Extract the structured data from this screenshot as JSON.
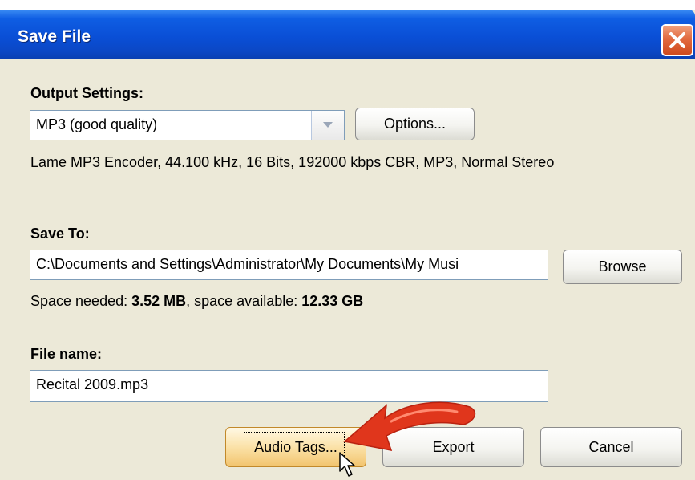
{
  "window": {
    "title": "Save File"
  },
  "output_settings": {
    "label": "Output Settings:",
    "selected_format": "MP3 (good quality)",
    "options_button": "Options...",
    "encoder_info": "Lame MP3 Encoder, 44.100 kHz, 16 Bits, 192000 kbps CBR, MP3, Normal Stereo"
  },
  "save_to": {
    "label": "Save To:",
    "path": "C:\\Documents and Settings\\Administrator\\My Documents\\My Musi",
    "browse_button": "Browse",
    "space_needed_label": "Space needed: ",
    "space_needed_value": "3.52 MB",
    "space_available_label": ", space available: ",
    "space_available_value": "12.33 GB"
  },
  "file_name": {
    "label": "File name:",
    "value": "Recital 2009.mp3"
  },
  "buttons": {
    "audio_tags": "Audio Tags...",
    "export": "Export",
    "cancel": "Cancel"
  },
  "annotation": {
    "arrow_color": "#e0361c"
  }
}
